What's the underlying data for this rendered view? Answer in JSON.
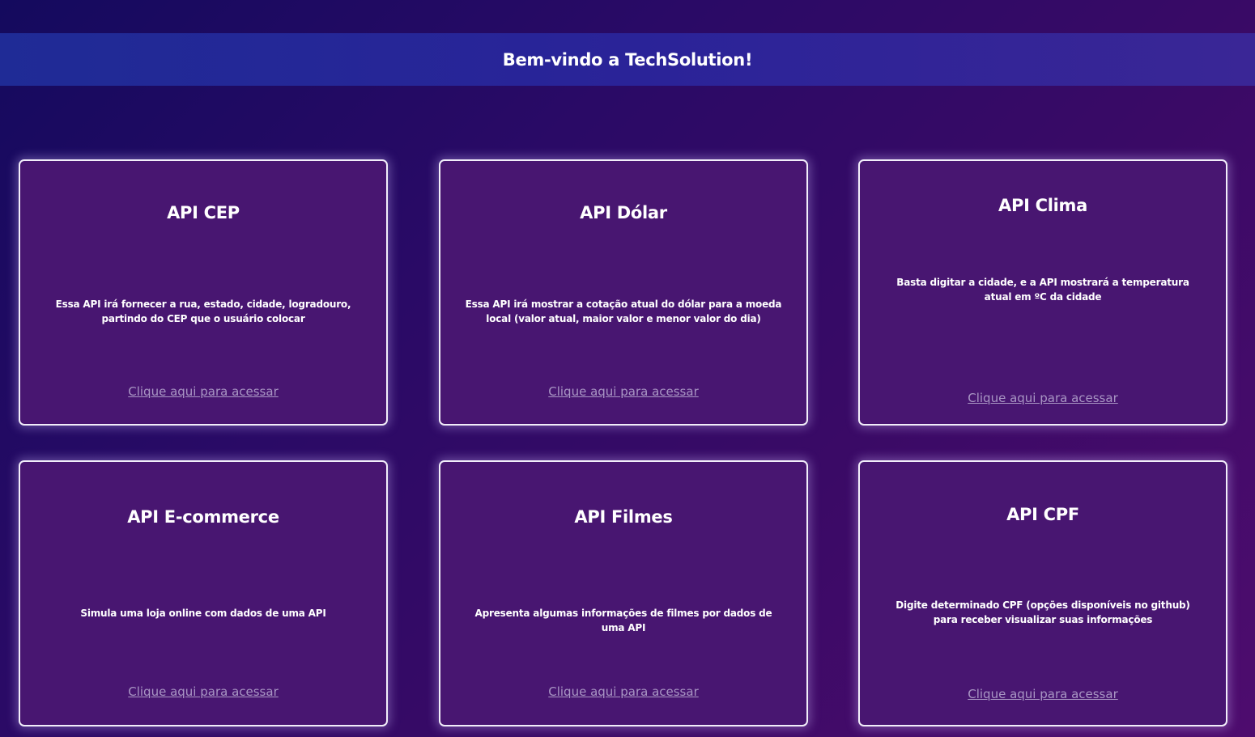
{
  "header": {
    "title": "Bem-vindo a TechSolution!"
  },
  "cards": [
    {
      "title": "API CEP",
      "description": "Essa API irá fornecer a rua, estado, cidade, logradouro, partindo do CEP que o usuário colocar",
      "link": "Clique aqui para acessar"
    },
    {
      "title": "API Dólar",
      "description": "Essa API irá mostrar a cotação atual do dólar para a moeda local (valor atual, maior valor e menor valor do dia)",
      "link": "Clique aqui para acessar"
    },
    {
      "title": "API Clima",
      "description": "Basta digitar a cidade, e a API mostrará a temperatura atual em ºC da cidade",
      "link": "Clique aqui para acessar"
    },
    {
      "title": "API E-commerce",
      "description": "Simula uma loja online com dados de uma API",
      "link": "Clique aqui para acessar"
    },
    {
      "title": "API Filmes",
      "description": "Apresenta algumas informações de filmes por dados de uma API",
      "link": "Clique aqui para acessar"
    },
    {
      "title": "API CPF",
      "description": "Digite determinado CPF (opções disponíveis no github) para receber visualizar suas informações",
      "link": "Clique aqui para acessar"
    }
  ],
  "colors": {
    "card_background": "#481671",
    "card_border": "#f2eefa",
    "link": "#a996c4",
    "header_background": "#2a2398"
  }
}
